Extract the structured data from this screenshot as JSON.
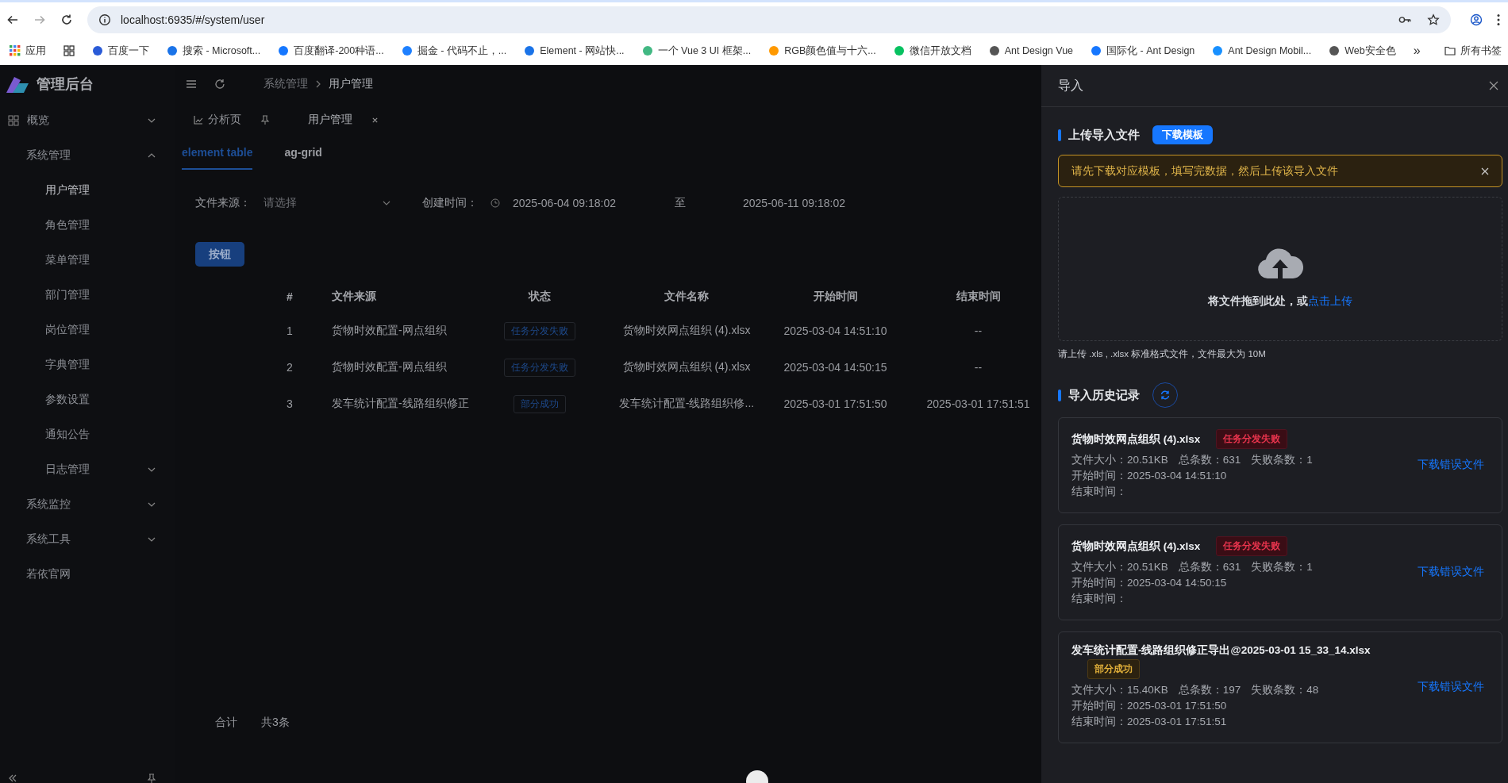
{
  "browser": {
    "url": "localhost:6935/#/system/user",
    "forward_disabled": true,
    "bookmarks": [
      {
        "label": "应用"
      },
      {
        "label": "百度一下"
      },
      {
        "label": "搜索 - Microsoft..."
      },
      {
        "label": "百度翻译-200种语..."
      },
      {
        "label": "掘金 - 代码不止，..."
      },
      {
        "label": "Element - 网站快..."
      },
      {
        "label": "一个 Vue 3 UI 框架..."
      },
      {
        "label": "RGB颜色值与十六..."
      },
      {
        "label": "微信开放文档"
      },
      {
        "label": "Ant Design Vue"
      },
      {
        "label": "国际化 - Ant Design"
      },
      {
        "label": "Ant Design Mobil..."
      },
      {
        "label": "Web安全色"
      }
    ],
    "overflow": "»",
    "all_bookmarks": "所有书签"
  },
  "sidebar": {
    "brand": "管理后台",
    "items": [
      {
        "label": "概览",
        "expanded": false,
        "selected": false
      },
      {
        "label": "系统管理",
        "expanded": true,
        "selected": false,
        "children": [
          {
            "label": "用户管理",
            "selected": true
          },
          {
            "label": "角色管理",
            "selected": false
          },
          {
            "label": "菜单管理",
            "selected": false
          },
          {
            "label": "部门管理",
            "selected": false
          },
          {
            "label": "岗位管理",
            "selected": false
          },
          {
            "label": "字典管理",
            "selected": false
          },
          {
            "label": "参数设置",
            "selected": false
          },
          {
            "label": "通知公告",
            "selected": false
          },
          {
            "label": "日志管理",
            "expanded": false,
            "selected": false
          }
        ]
      },
      {
        "label": "系统监控",
        "expanded": false,
        "selected": false
      },
      {
        "label": "系统工具",
        "expanded": false,
        "selected": false
      },
      {
        "label": "若依官网",
        "selected": false
      }
    ]
  },
  "breadcrumb": [
    "系统管理",
    "用户管理"
  ],
  "page_tabs": [
    {
      "label": "分析页",
      "selected": false,
      "kind": "pinned"
    },
    {
      "label": "用户管理",
      "selected": true,
      "kind": "closable"
    }
  ],
  "view_tabs": [
    {
      "label": "element table",
      "selected": true
    },
    {
      "label": "ag-grid",
      "selected": false
    }
  ],
  "filters": {
    "source_label": "文件来源：",
    "source_placeholder": "请选择",
    "time_label": "创建时间：",
    "start": "2025-06-04 09:18:02",
    "separator": "至",
    "end": "2025-06-11 09:18:02"
  },
  "action_button": "按钮",
  "table": {
    "columns": [
      "#",
      "文件来源",
      "状态",
      "文件名称",
      "开始时间",
      "结束时间"
    ],
    "rows": [
      {
        "index": "1",
        "source": "货物时效配置-网点组织",
        "status": "任务分发失败",
        "file": "货物时效网点组织 (4).xlsx",
        "start": "2025-03-04 14:51:10",
        "end": "--"
      },
      {
        "index": "2",
        "source": "货物时效配置-网点组织",
        "status": "任务分发失败",
        "file": "货物时效网点组织 (4).xlsx",
        "start": "2025-03-04 14:50:15",
        "end": "--"
      },
      {
        "index": "3",
        "source": "发车统计配置-线路组织修正",
        "status": "部分成功",
        "file": "发车统计配置-线路组织修...",
        "start": "2025-03-01 17:51:50",
        "end": "2025-03-01 17:51:51"
      }
    ]
  },
  "summary": {
    "label": "合计",
    "count": "共3条"
  },
  "drawer": {
    "title": "导入",
    "upload_title": "上传导入文件",
    "template_button": "下载模板",
    "alert": "请先下载对应模板，填写完数据，然后上传该导入文件",
    "drop_text": "将文件拖到此处，或",
    "drop_link": "点击上传",
    "hint": "请上传 .xls , .xlsx 标准格式文件，文件最大为 10M",
    "history_title": "导入历史记录",
    "records": [
      {
        "name": "货物时效网点组织 (4).xlsx",
        "status": "任务分发失败",
        "kind": "fail",
        "stats": [
          "文件大小：20.51KB",
          "总条数：631",
          "失败条数：1"
        ],
        "start": "开始时间：2025-03-04 14:51:10",
        "end": "结束时间：",
        "link": "下载错误文件"
      },
      {
        "name": "货物时效网点组织 (4).xlsx",
        "status": "任务分发失败",
        "kind": "fail",
        "stats": [
          "文件大小：20.51KB",
          "总条数：631",
          "失败条数：1"
        ],
        "start": "开始时间：2025-03-04 14:50:15",
        "end": "结束时间：",
        "link": "下载错误文件"
      },
      {
        "name": "发车统计配置-线路组织修正导出@2025-03-01 15_33_14.xlsx",
        "status": "部分成功",
        "kind": "partial",
        "stats": [
          "文件大小：15.40KB",
          "总条数：197",
          "失败条数：48"
        ],
        "start": "开始时间：2025-03-01 17:51:50",
        "end": "结束时间：2025-03-01 17:51:51",
        "link": "下载错误文件"
      }
    ]
  }
}
